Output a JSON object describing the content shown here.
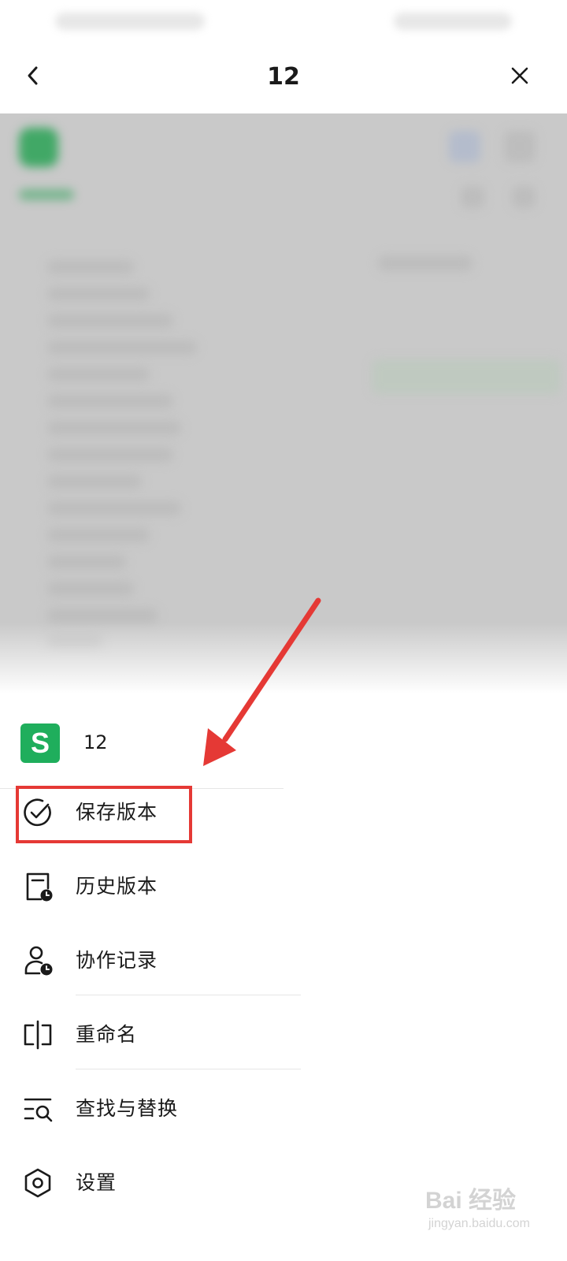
{
  "header": {
    "title": "12",
    "back_icon": "chevron-left-icon",
    "close_icon": "close-icon"
  },
  "file": {
    "name": "12",
    "icon_letter": "S",
    "icon_color": "#1fae5c"
  },
  "menu": {
    "items": [
      {
        "label": "保存版本",
        "icon": "check-circle-icon"
      },
      {
        "label": "历史版本",
        "icon": "history-document-icon"
      },
      {
        "label": "协作记录",
        "icon": "user-clock-icon"
      },
      {
        "label": "重命名",
        "icon": "rename-icon"
      },
      {
        "label": "查找与替换",
        "icon": "find-replace-icon"
      },
      {
        "label": "设置",
        "icon": "settings-hexagon-icon"
      }
    ]
  },
  "annotation": {
    "highlight_color": "#e53935"
  },
  "watermark": {
    "main": "Bai 经验",
    "sub": "jingyan.baidu.com"
  }
}
